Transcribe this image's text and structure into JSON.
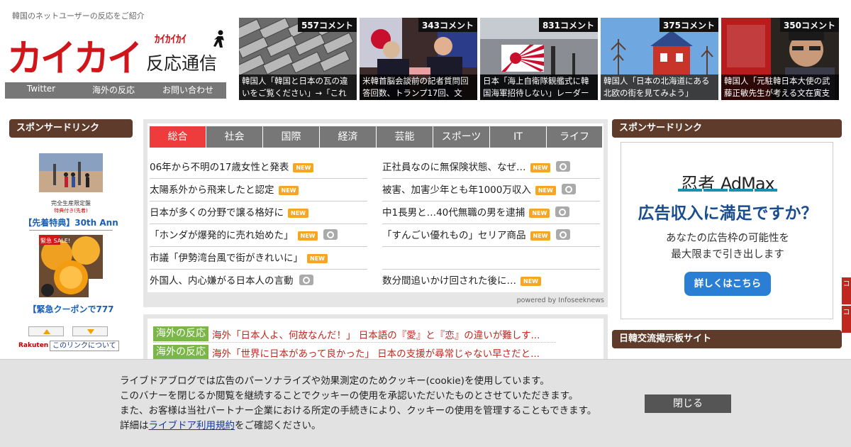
{
  "header": {
    "tagline": "韓国のネットユーザーの反応をご紹介",
    "logo_main": "カイカイ",
    "logo_kana": "ｶｲｶｲｶｲ",
    "logo_sub": "反応通信",
    "nav": [
      "Twitter",
      "海外の反応",
      "お問い合わせ"
    ]
  },
  "thumbs": [
    {
      "count": "557コメント",
      "caption": "韓国人「韓国と日本の瓦の違いをご覧ください」→「これ"
    },
    {
      "count": "343コメント",
      "caption": "米韓首脳会談前の記者質問回答回数、トランプ17回、文"
    },
    {
      "count": "831コメント",
      "caption": "日本「海上自衛隊観艦式に韓国海軍招待しない」レーダー"
    },
    {
      "count": "375コメント",
      "caption": "韓国人「日本の北海道にある北欧の街を見てみよう」"
    },
    {
      "count": "350コメント",
      "caption": "韓国人「元駐韓日本大使の武藤正敏先生が考える文在寅支"
    }
  ],
  "left_ad": {
    "heading": "スポンサードリンク",
    "item1_note": "完全生産限定盤",
    "item1_note2": "特典付き(先着)",
    "item1_link": "【先着特典】30th Ann",
    "item2_sale": "緊急 SALE!",
    "item2_link": "【緊急クーポンで777",
    "rakuten": "Rakuten",
    "about_link": "このリンクについて"
  },
  "news": {
    "tabs": [
      "総合",
      "社会",
      "国際",
      "経済",
      "芸能",
      "スポーツ",
      "IT",
      "ライフ"
    ],
    "new_label": "NEW",
    "left": [
      {
        "text": "06年から不明の17歳女性と発表",
        "new": true,
        "cam": false
      },
      {
        "text": "太陽系外から飛来したと認定",
        "new": true,
        "cam": false
      },
      {
        "text": "日本が多くの分野で譲る格好に",
        "new": true,
        "cam": false
      },
      {
        "text": "「ホンダが爆発的に売れ始めた」",
        "new": true,
        "cam": true
      },
      {
        "text": "市議「伊勢湾台風で街がきれいに」",
        "new": true,
        "cam": false
      },
      {
        "text": "外国人、内心嫌がる日本人の言動",
        "new": false,
        "cam": true
      }
    ],
    "right": [
      {
        "text": "正社員なのに無保険状態、なぜ…",
        "new": true,
        "cam": true
      },
      {
        "text": "被害、加害少年とも年1000万収入",
        "new": true,
        "cam": true
      },
      {
        "text": "中1長男と…40代無職の男を逮捕",
        "new": true,
        "cam": true
      },
      {
        "text": "「すんごい優れもの」セリア商品",
        "new": true,
        "cam": true
      },
      {
        "text": "",
        "new": false,
        "cam": false
      },
      {
        "text": "数分間追いかけ回された後に…",
        "new": true,
        "cam": false
      }
    ],
    "powered": "powered by Infoseeknews"
  },
  "kaigai": {
    "tag": "海外の反応",
    "items": [
      "海外「日本人よ、何故なんだ！」 日本語の『愛』と『恋』の違いが難しす...",
      "海外「世界に日本があって良かった」 日本の支援が尋常じゃない早さだと..."
    ]
  },
  "right_ad": {
    "heading": "スポンサードリンク",
    "logo_a": "忍者",
    "logo_b": "AdMax",
    "headline": "広告収入に満足ですか？",
    "line1": "あなたの広告枠の可能性を",
    "line2": "最大限まで引き出します",
    "button": "詳しくはこちら",
    "heading2": "日韓交流掲示板サイト"
  },
  "side_tabs": [
    "コ",
    "コ"
  ],
  "cookie": {
    "line1": "ライブドアブログでは広告のパーソナライズや効果測定のためクッキー(cookie)を使用しています。",
    "line2": "このバナーを閉じるか閲覧を継続することでクッキーの使用を承認いただいたものとさせていただきます。",
    "line3": "また、お客様は当社パートナー企業における所定の手続きにより、クッキーの使用を管理することもできます。",
    "line4_pre": "詳細は",
    "line4_link": "ライブドア利用規約",
    "line4_post": "をご確認ください。",
    "close": "閉じる"
  }
}
